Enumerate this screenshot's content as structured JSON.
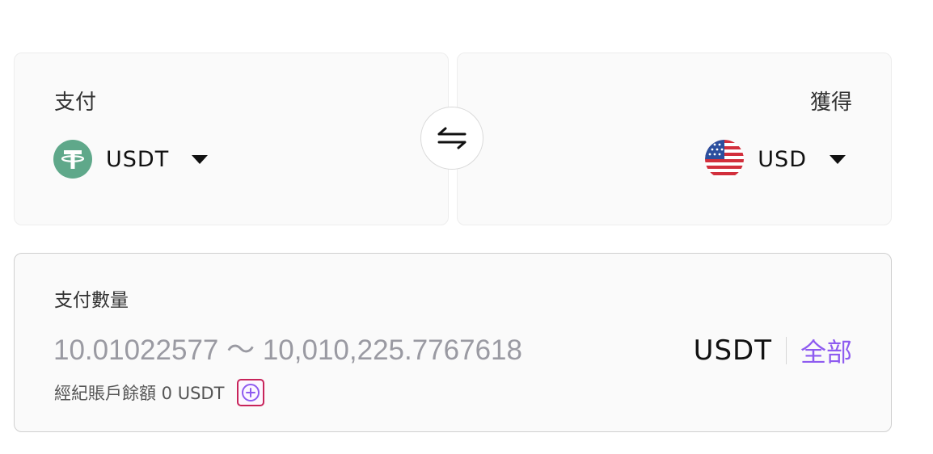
{
  "pay": {
    "label": "支付",
    "currency": "USDT",
    "icon": "tether-icon",
    "icon_color": "#5fa88a"
  },
  "receive": {
    "label": "獲得",
    "currency": "USD",
    "icon": "us-flag-icon"
  },
  "swap": {
    "icon": "swap-arrows-icon"
  },
  "amount": {
    "label": "支付數量",
    "placeholder": "10.01022577 ～ 10,010,225.7767618",
    "value": "",
    "unit": "USDT",
    "max_label": "全部",
    "max_color": "#8e5bf0",
    "balance_text": "經紀賬戶餘額 0 USDT",
    "add_icon": "plus-circle-icon",
    "add_highlight_color": "#c8245a"
  }
}
